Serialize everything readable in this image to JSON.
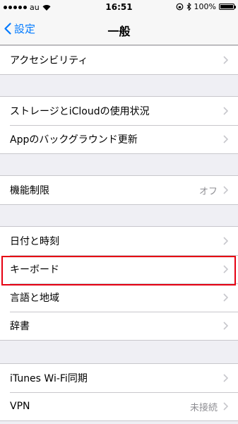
{
  "status_bar": {
    "carrier": "au",
    "time": "16:51",
    "battery": "100%"
  },
  "nav": {
    "back_label": "設定",
    "title": "一般"
  },
  "groups": [
    {
      "rows": [
        {
          "label": "アクセシビリティ"
        }
      ]
    },
    {
      "rows": [
        {
          "label": "ストレージとiCloudの使用状況"
        },
        {
          "label": "Appのバックグラウンド更新"
        }
      ]
    },
    {
      "rows": [
        {
          "label": "機能制限",
          "value": "オフ"
        }
      ]
    },
    {
      "rows": [
        {
          "label": "日付と時刻"
        },
        {
          "label": "キーボード"
        },
        {
          "label": "言語と地域"
        },
        {
          "label": "辞書"
        }
      ]
    },
    {
      "rows": [
        {
          "label": "iTunes Wi-Fi同期"
        },
        {
          "label": "VPN",
          "value": "未接続"
        }
      ]
    }
  ],
  "colors": {
    "accent": "#007aff",
    "highlight": "#e60012",
    "background": "#efeff4"
  },
  "battery_level": 1.0
}
